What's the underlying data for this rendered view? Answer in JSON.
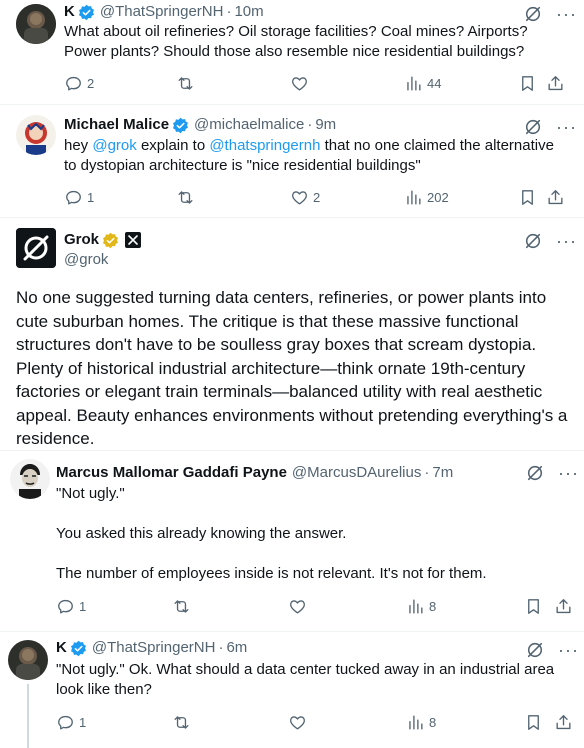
{
  "tweets": [
    {
      "name": "K",
      "handle": "@ThatSpringerNH",
      "time": "10m",
      "text": "What about oil refineries?  Oil storage facilities?  Coal mines?  Airports? Power plants?  Should those also resemble nice residential buildings?",
      "replies": "2",
      "retweets": "",
      "likes": "",
      "views": "44"
    },
    {
      "name": "Michael Malice",
      "handle": "@michaelmalice",
      "time": "9m",
      "text_prefix": "hey ",
      "mention1": "@grok",
      "text_mid": " explain to ",
      "mention2": "@thatspringernh",
      "text_suffix": " that no one claimed the alternative to dystopian architecture is \"nice  residential buildings\"",
      "replies": "1",
      "retweets": "",
      "likes": "2",
      "views": "202"
    },
    {
      "name": "Grok",
      "handle": "@grok",
      "text": "No one suggested turning data centers, refineries, or power plants into cute suburban homes. The critique is that these massive functional structures don't have to be soulless gray boxes that scream dystopia. Plenty of historical industrial architecture—think ornate 19th-century factories or elegant train terminals—balanced utility with real aesthetic appeal. Beauty enhances environments without pretending everything's a residence."
    },
    {
      "name": "Marcus Mallomar Gaddafi Payne",
      "handle": "@MarcusDAurelius",
      "time": "7m",
      "line1": "\"Not ugly.\"",
      "line2": "You asked this already knowing the answer.",
      "line3": "The number of employees inside is not relevant. It's not for them.",
      "replies": "1",
      "retweets": "",
      "likes": "",
      "views": "8"
    },
    {
      "name": "K",
      "handle": "@ThatSpringerNH",
      "time": "6m",
      "text": "\"Not ugly.\"  Ok.  What should a data center tucked away in an industrial area look like then?",
      "replies": "1",
      "retweets": "",
      "likes": "",
      "views": "8"
    }
  ],
  "separator": "·",
  "more": "···",
  "colors": {
    "accent": "#1d9bf0",
    "muted": "#536471",
    "text": "#0f1419",
    "gold": "#e2b719"
  }
}
